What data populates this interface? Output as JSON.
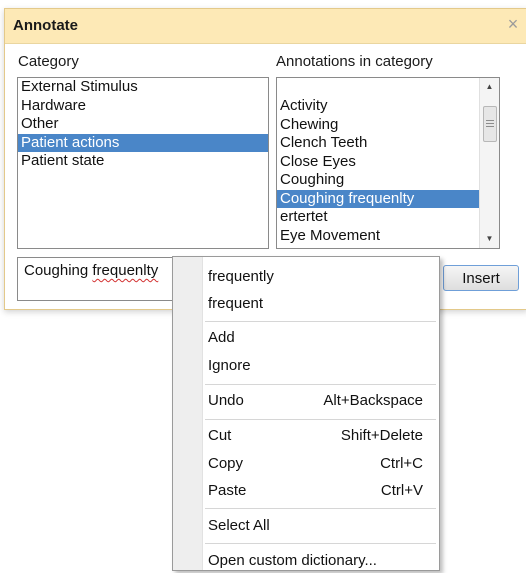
{
  "dialog": {
    "title": "Annotate",
    "close_glyph": "×",
    "category_label": "Category",
    "annotations_label": "Annotations in category",
    "categories": [
      "External Stimulus",
      "Hardware",
      "Other",
      "Patient actions",
      "Patient state"
    ],
    "selected_category": "Patient actions",
    "annotations": [
      "Activity",
      "Chewing",
      "Clench Teeth",
      "Close Eyes",
      "Coughing",
      "Coughing frequenlty",
      "ertertet",
      "Eye Movement"
    ],
    "selected_annotation": "Coughing frequenlty",
    "text_value_word1": "Coughing",
    "text_value_word2": "frequenlty",
    "insert_label": "Insert",
    "selection_color": "#4a86c8"
  },
  "context_menu": {
    "suggestion_1": "frequently",
    "suggestion_2": "frequent",
    "add": "Add",
    "ignore": "Ignore",
    "undo": "Undo",
    "undo_shortcut": "Alt+Backspace",
    "cut": "Cut",
    "cut_shortcut": "Shift+Delete",
    "copy": "Copy",
    "copy_shortcut": "Ctrl+C",
    "paste": "Paste",
    "paste_shortcut": "Ctrl+V",
    "select_all": "Select All",
    "open_dictionary": "Open custom dictionary..."
  }
}
